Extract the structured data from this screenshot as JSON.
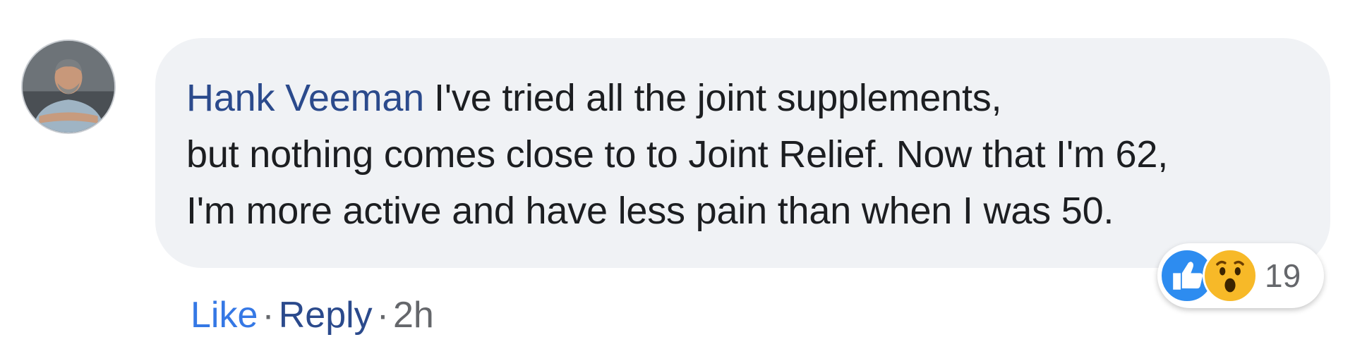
{
  "comment": {
    "author": "Hank Veeman",
    "line1": "I've tried all the joint supplements,",
    "line2": "but nothing comes close to to Joint Relief. Now that I'm 62,",
    "line3": "I'm more active and have less pain than when I was 50."
  },
  "reactions": {
    "icons": [
      "like-icon",
      "wow-icon"
    ],
    "count": "19",
    "colors": {
      "like": "#2d8cf0",
      "wow": "#f7b928"
    }
  },
  "actions": {
    "like_label": "Like",
    "reply_label": "Reply",
    "separator": "·",
    "timestamp": "2h"
  },
  "colors": {
    "author": "#2b4a8c",
    "bubble_bg": "#f0f2f5",
    "text": "#1c1e21",
    "muted": "#65676b"
  }
}
